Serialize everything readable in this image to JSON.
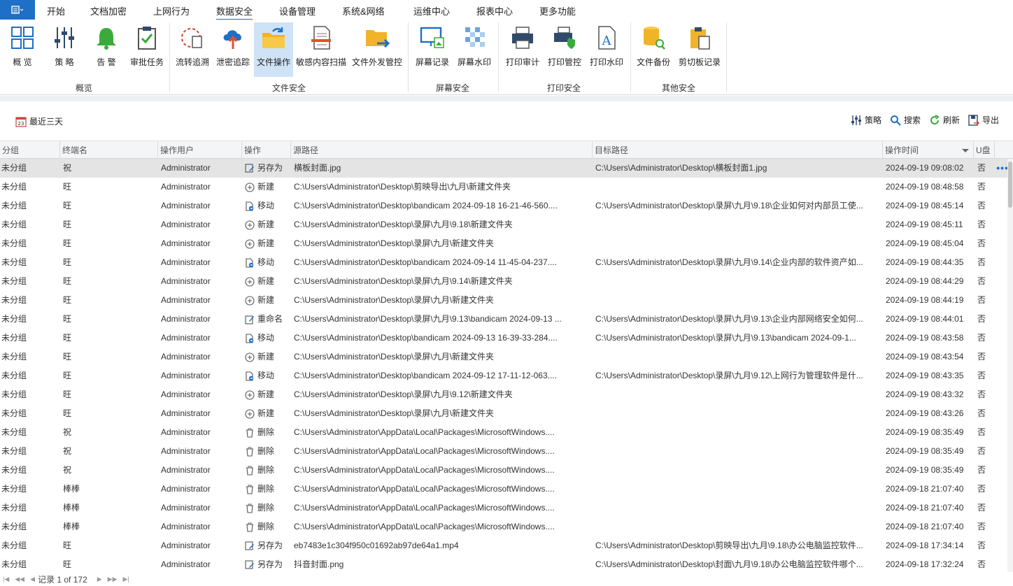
{
  "menu": {
    "app_icon": "menu-icon",
    "items": [
      "开始",
      "文档加密",
      "上网行为",
      "数据安全",
      "设备管理",
      "系统&网络",
      "运维中心",
      "报表中心",
      "更多功能"
    ],
    "active_index": 3
  },
  "ribbon": {
    "buttons": [
      "概 览",
      "策 略",
      "告 警",
      "审批任务",
      "流转追溯",
      "泄密追踪",
      "文件操作",
      "敏感内容扫描",
      "文件外发管控",
      "屏幕记录",
      "屏幕水印",
      "打印审计",
      "打印管控",
      "打印水印",
      "文件备份",
      "剪切板记录"
    ],
    "active_button": "文件操作",
    "groups": [
      "概览",
      "文件安全",
      "屏幕安全",
      "打印安全",
      "其他安全"
    ]
  },
  "toolbar": {
    "date_range": "最近三天",
    "policy": "策略",
    "search": "搜索",
    "refresh": "刷新",
    "export": "导出"
  },
  "table": {
    "columns": [
      "分组",
      "终端名",
      "操作用户",
      "操作",
      "源路径",
      "目标路径",
      "操作时间",
      "U盘"
    ],
    "rows": [
      [
        "未分组",
        "祝",
        "Administrator",
        "另存为",
        "横板封面.jpg",
        "C:\\Users\\Administrator\\Desktop\\横板封面1.jpg",
        "2024-09-19 09:08:02",
        "否"
      ],
      [
        "未分组",
        "旺",
        "Administrator",
        "新建",
        "C:\\Users\\Administrator\\Desktop\\剪映导出\\九月\\新建文件夹",
        "",
        "2024-09-19 08:48:58",
        "否"
      ],
      [
        "未分组",
        "旺",
        "Administrator",
        "移动",
        "C:\\Users\\Administrator\\Desktop\\bandicam 2024-09-18 16-21-46-560....",
        "C:\\Users\\Administrator\\Desktop\\录屏\\九月\\9.18\\企业如何对内部员工使...",
        "2024-09-19 08:45:14",
        "否"
      ],
      [
        "未分组",
        "旺",
        "Administrator",
        "新建",
        "C:\\Users\\Administrator\\Desktop\\录屏\\九月\\9.18\\新建文件夹",
        "",
        "2024-09-19 08:45:11",
        "否"
      ],
      [
        "未分组",
        "旺",
        "Administrator",
        "新建",
        "C:\\Users\\Administrator\\Desktop\\录屏\\九月\\新建文件夹",
        "",
        "2024-09-19 08:45:04",
        "否"
      ],
      [
        "未分组",
        "旺",
        "Administrator",
        "移动",
        "C:\\Users\\Administrator\\Desktop\\bandicam 2024-09-14 11-45-04-237....",
        "C:\\Users\\Administrator\\Desktop\\录屏\\九月\\9.14\\企业内部的软件资产如...",
        "2024-09-19 08:44:35",
        "否"
      ],
      [
        "未分组",
        "旺",
        "Administrator",
        "新建",
        "C:\\Users\\Administrator\\Desktop\\录屏\\九月\\9.14\\新建文件夹",
        "",
        "2024-09-19 08:44:29",
        "否"
      ],
      [
        "未分组",
        "旺",
        "Administrator",
        "新建",
        "C:\\Users\\Administrator\\Desktop\\录屏\\九月\\新建文件夹",
        "",
        "2024-09-19 08:44:19",
        "否"
      ],
      [
        "未分组",
        "旺",
        "Administrator",
        "重命名",
        "C:\\Users\\Administrator\\Desktop\\录屏\\九月\\9.13\\bandicam 2024-09-13 ...",
        "C:\\Users\\Administrator\\Desktop\\录屏\\九月\\9.13\\企业内部网络安全如何...",
        "2024-09-19 08:44:01",
        "否"
      ],
      [
        "未分组",
        "旺",
        "Administrator",
        "移动",
        "C:\\Users\\Administrator\\Desktop\\bandicam 2024-09-13 16-39-33-284....",
        "C:\\Users\\Administrator\\Desktop\\录屏\\九月\\9.13\\bandicam 2024-09-1...",
        "2024-09-19 08:43:58",
        "否"
      ],
      [
        "未分组",
        "旺",
        "Administrator",
        "新建",
        "C:\\Users\\Administrator\\Desktop\\录屏\\九月\\新建文件夹",
        "",
        "2024-09-19 08:43:54",
        "否"
      ],
      [
        "未分组",
        "旺",
        "Administrator",
        "移动",
        "C:\\Users\\Administrator\\Desktop\\bandicam 2024-09-12 17-11-12-063....",
        "C:\\Users\\Administrator\\Desktop\\录屏\\九月\\9.12\\上网行为管理软件是什...",
        "2024-09-19 08:43:35",
        "否"
      ],
      [
        "未分组",
        "旺",
        "Administrator",
        "新建",
        "C:\\Users\\Administrator\\Desktop\\录屏\\九月\\9.12\\新建文件夹",
        "",
        "2024-09-19 08:43:32",
        "否"
      ],
      [
        "未分组",
        "旺",
        "Administrator",
        "新建",
        "C:\\Users\\Administrator\\Desktop\\录屏\\九月\\新建文件夹",
        "",
        "2024-09-19 08:43:26",
        "否"
      ],
      [
        "未分组",
        "祝",
        "Administrator",
        "删除",
        "C:\\Users\\Administrator\\AppData\\Local\\Packages\\MicrosoftWindows....",
        "",
        "2024-09-19 08:35:49",
        "否"
      ],
      [
        "未分组",
        "祝",
        "Administrator",
        "删除",
        "C:\\Users\\Administrator\\AppData\\Local\\Packages\\MicrosoftWindows....",
        "",
        "2024-09-19 08:35:49",
        "否"
      ],
      [
        "未分组",
        "祝",
        "Administrator",
        "删除",
        "C:\\Users\\Administrator\\AppData\\Local\\Packages\\MicrosoftWindows....",
        "",
        "2024-09-19 08:35:49",
        "否"
      ],
      [
        "未分组",
        "棒棒",
        "Administrator",
        "删除",
        "C:\\Users\\Administrator\\AppData\\Local\\Packages\\MicrosoftWindows....",
        "",
        "2024-09-18 21:07:40",
        "否"
      ],
      [
        "未分组",
        "棒棒",
        "Administrator",
        "删除",
        "C:\\Users\\Administrator\\AppData\\Local\\Packages\\MicrosoftWindows....",
        "",
        "2024-09-18 21:07:40",
        "否"
      ],
      [
        "未分组",
        "棒棒",
        "Administrator",
        "删除",
        "C:\\Users\\Administrator\\AppData\\Local\\Packages\\MicrosoftWindows....",
        "",
        "2024-09-18 21:07:40",
        "否"
      ],
      [
        "未分组",
        "旺",
        "Administrator",
        "另存为",
        "eb7483e1c304f950c01692ab97de64a1.mp4",
        "C:\\Users\\Administrator\\Desktop\\剪映导出\\九月\\9.18\\办公电脑监控软件...",
        "2024-09-18 17:34:14",
        "否"
      ],
      [
        "未分组",
        "旺",
        "Administrator",
        "另存为",
        "抖音封面.png",
        "C:\\Users\\Administrator\\Desktop\\封面\\九月\\9.18\\办公电脑监控软件哪个...",
        "2024-09-18 17:32:24",
        "否"
      ]
    ],
    "selected_row": 0
  },
  "footer": {
    "records": "记录 1 of 172"
  },
  "colors": {
    "accent": "#1e6fc6",
    "selected_ribbon": "#cfe3f7",
    "selected_row": "#e4e4e4"
  }
}
